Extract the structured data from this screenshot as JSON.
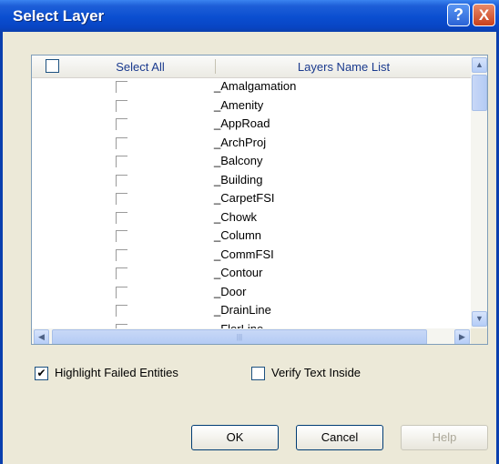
{
  "window": {
    "title": "Select Layer"
  },
  "title_buttons": {
    "help": "?",
    "close": "X"
  },
  "list": {
    "header": {
      "col1": "Select All",
      "col2": "Layers Name List"
    },
    "rows": [
      "_Amalgamation",
      "_Amenity",
      "_AppRoad",
      "_ArchProj",
      "_Balcony",
      "_Building",
      "_CarpetFSI",
      "_Chowk",
      "_Column",
      "_CommFSI",
      "_Contour",
      "_Door",
      "_DrainLine",
      "_FlorLine"
    ]
  },
  "options": {
    "highlight_label": "Highlight Failed Entities",
    "highlight_checked": true,
    "verify_label": "Verify Text Inside",
    "verify_checked": false
  },
  "buttons": {
    "ok": "OK",
    "cancel": "Cancel",
    "help": "Help"
  }
}
